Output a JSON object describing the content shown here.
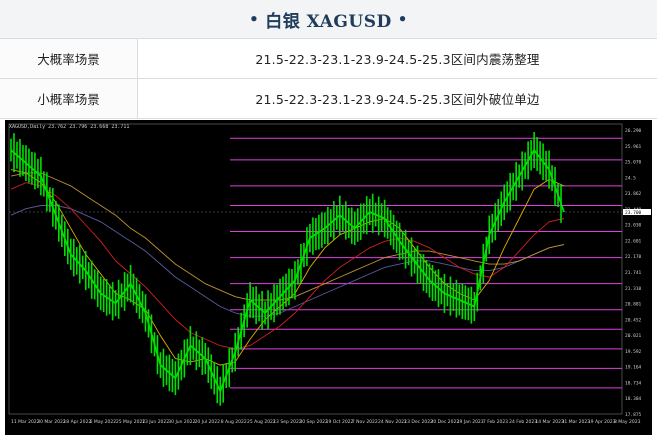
{
  "header": {
    "title": "白银 XAGUSD",
    "bullet": "•"
  },
  "scenarios": [
    {
      "label": "大概率场景",
      "text": "21.5-22.3-23.1-23.9-24.5-25.3区间内震荡整理"
    },
    {
      "label": "小概率场景",
      "text": "21.5-22.3-23.1-23.9-24.5-25.3区间外破位单边"
    }
  ],
  "chart_data": {
    "type": "line",
    "title": "XAGUSD,Daily",
    "info": "XAGUSD,Daily 23.762 23.796 23.668 23.711",
    "x": [
      "11 Mar 2022",
      "30 Mar 2022",
      "18 Apr 2022",
      "6 May 2022",
      "25 May 2022",
      "13 Jun 2022",
      "30 Jun 2022",
      "20 Jul 2022",
      "8 Aug 2022",
      "25 Aug 2022",
      "13 Sep 2022",
      "30 Sep 2022",
      "19 Oct 2022",
      "7 Nov 2022",
      "24 Nov 2022",
      "13 Dec 2022",
      "30 Dec 2022",
      "19 Jan 2023",
      "7 Feb 2023",
      "24 Feb 2023",
      "14 Mar 2023",
      "31 Mar 2023",
      "19 Apr 2023",
      "8 May 2023"
    ],
    "series": [
      {
        "color": "#00e000",
        "values": [
          25.6,
          25.2,
          24.8,
          23.6,
          22.4,
          21.9,
          21.2,
          20.9,
          21.5,
          20.6,
          19.0,
          18.6,
          19.6,
          19.2,
          18.2,
          19.4,
          21.0,
          20.6,
          21.1,
          21.6,
          22.9,
          23.2,
          23.6,
          23.2,
          23.7,
          23.5,
          22.8,
          22.2,
          21.6,
          21.2,
          21.0,
          20.8,
          23.0,
          24.0,
          24.8,
          25.6,
          25.0,
          23.7
        ]
      },
      {
        "color": "#e0b000",
        "values": [
          25.0,
          24.9,
          24.6,
          24.0,
          23.2,
          22.4,
          21.8,
          21.2,
          21.0,
          20.7,
          19.9,
          19.2,
          19.1,
          19.2,
          19.0,
          19.1,
          19.8,
          20.4,
          20.8,
          21.2,
          22.0,
          22.6,
          23.0,
          23.2,
          23.4,
          23.5,
          23.2,
          22.6,
          22.0,
          21.5,
          21.2,
          21.0,
          21.6,
          22.6,
          23.5,
          24.4,
          24.7,
          24.5
        ]
      },
      {
        "color": "#d02020",
        "values": [
          24.4,
          24.6,
          24.5,
          24.2,
          23.8,
          23.3,
          22.8,
          22.2,
          21.8,
          21.4,
          20.9,
          20.4,
          20.0,
          19.8,
          19.6,
          19.5,
          19.6,
          19.9,
          20.2,
          20.6,
          21.1,
          21.6,
          22.0,
          22.3,
          22.6,
          22.8,
          22.9,
          22.8,
          22.6,
          22.3,
          22.0,
          21.8,
          21.7,
          22.0,
          22.5,
          23.0,
          23.4,
          23.5
        ]
      },
      {
        "color": "#c09030",
        "values": [
          24.8,
          24.9,
          24.9,
          24.7,
          24.5,
          24.2,
          23.9,
          23.6,
          23.2,
          22.9,
          22.5,
          22.1,
          21.8,
          21.5,
          21.3,
          21.1,
          21.0,
          21.0,
          21.0,
          21.1,
          21.3,
          21.5,
          21.7,
          21.9,
          22.1,
          22.3,
          22.4,
          22.5,
          22.5,
          22.4,
          22.3,
          22.2,
          22.1,
          22.1,
          22.2,
          22.4,
          22.6,
          22.7
        ]
      },
      {
        "color": "#5a5aa0",
        "values": [
          23.6,
          23.8,
          23.9,
          23.9,
          23.8,
          23.6,
          23.4,
          23.1,
          22.8,
          22.5,
          22.1,
          21.7,
          21.4,
          21.1,
          20.8,
          20.6,
          20.5,
          20.5,
          20.6,
          20.8,
          21.0,
          21.2,
          21.4,
          21.6,
          21.8,
          22.0,
          22.1,
          22.2,
          22.2,
          22.1,
          22.0,
          21.9,
          21.9,
          22.0,
          22.2,
          22.4,
          22.6,
          22.7
        ]
      }
    ],
    "levels": [
      25.961,
      25.3,
      24.5,
      23.9,
      23.1,
      22.3,
      21.5,
      20.7,
      20.1,
      19.5,
      18.9,
      18.3
    ],
    "ylim": [
      17.5,
      26.4
    ],
    "price_ticks": [
      "26.290",
      "25.961",
      "25.070",
      "24.5",
      "23.862",
      "23.449",
      "23.030",
      "22.601",
      "22.170",
      "21.741",
      "21.310",
      "20.881",
      "20.452",
      "20.021",
      "19.592",
      "19.164",
      "18.734",
      "18.304",
      "17.875"
    ],
    "grid": false
  }
}
